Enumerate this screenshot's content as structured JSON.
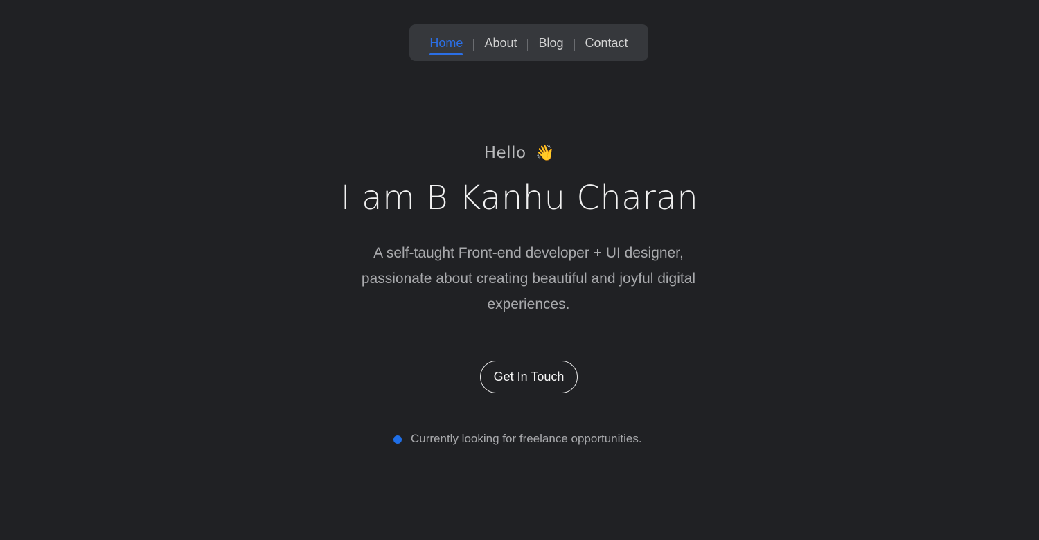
{
  "nav": {
    "items": [
      {
        "label": "Home",
        "active": true
      },
      {
        "label": "About",
        "active": false
      },
      {
        "label": "Blog",
        "active": false
      },
      {
        "label": "Contact",
        "active": false
      }
    ]
  },
  "hero": {
    "greeting": "Hello",
    "greeting_emoji": "👋",
    "title": "I am B Kanhu Charan",
    "description": "A self-taught Front-end developer + UI designer, passionate about creating beautiful and joyful digital experiences.",
    "cta_label": "Get In Touch",
    "status_text": "Currently looking for freelance opportunities."
  },
  "colors": {
    "background": "#202124",
    "nav_background": "#36383c",
    "accent": "#2b6fe6",
    "status_dot": "#1f6fe8"
  }
}
